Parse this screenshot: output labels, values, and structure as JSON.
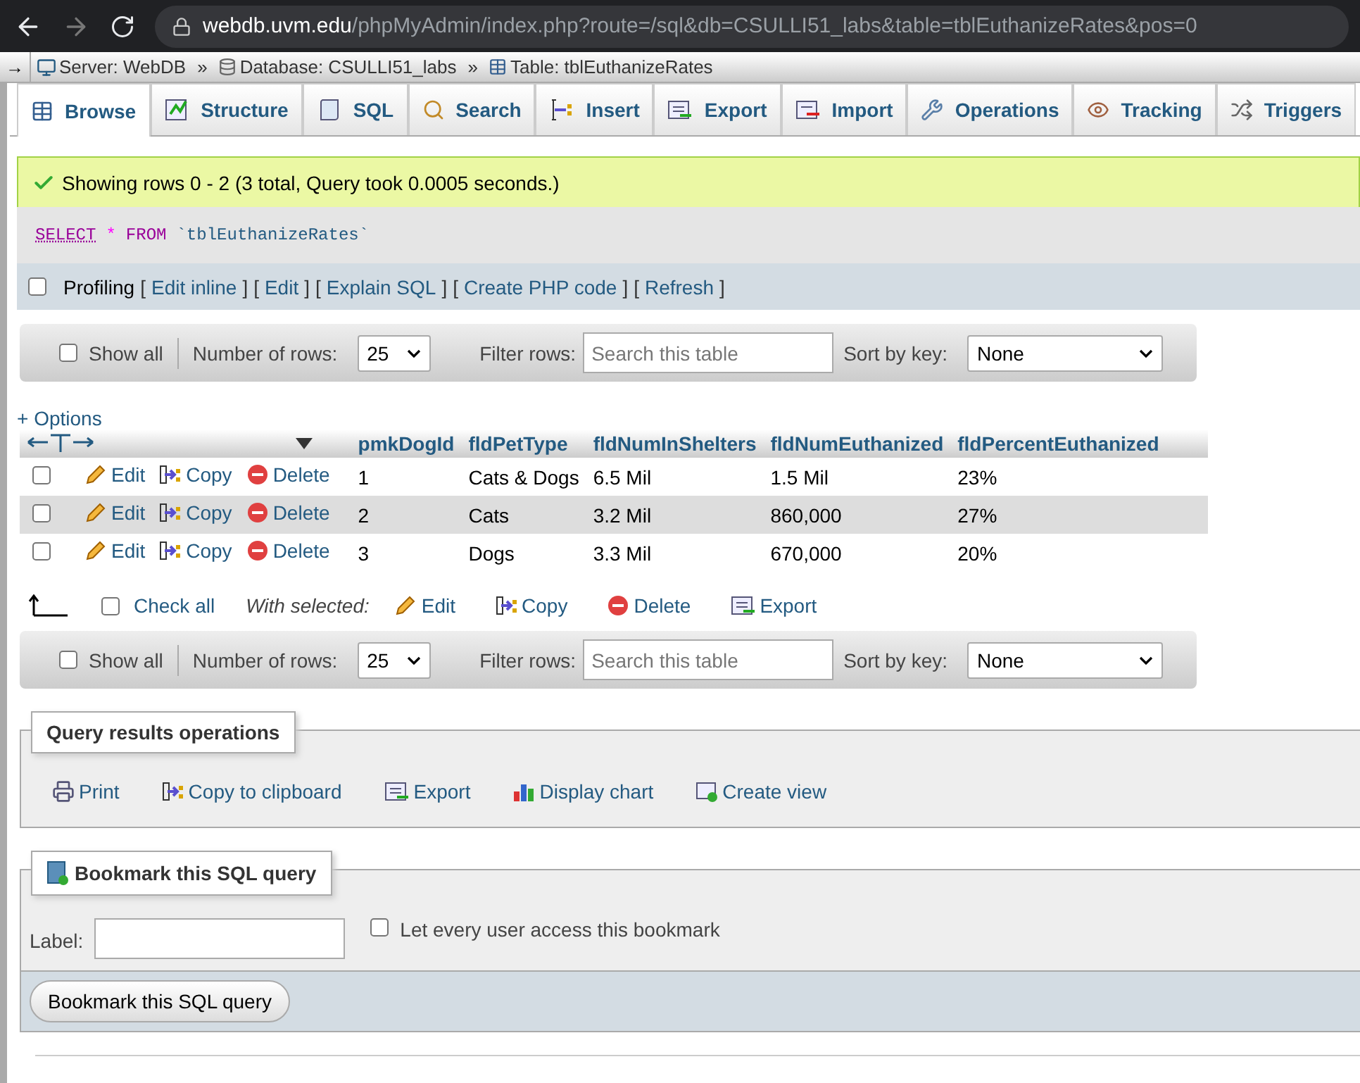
{
  "browser": {
    "host": "webdb.uvm.edu",
    "path": "/phpMyAdmin/index.php?route=/sql&db=CSULLI51_labs&table=tblEuthanizeRates&pos=0"
  },
  "nav_toggle": "→",
  "breadcrumbs": [
    {
      "kind": "server",
      "label": "Server: WebDB"
    },
    {
      "kind": "separator",
      "label": "»"
    },
    {
      "kind": "database",
      "label": "Database: CSULLI51_labs"
    },
    {
      "kind": "separator",
      "label": "»"
    },
    {
      "kind": "table",
      "label": "Table: tblEuthanizeRates"
    }
  ],
  "tabs": [
    {
      "label": "Browse",
      "selected": true
    },
    {
      "label": "Structure",
      "selected": false
    },
    {
      "label": "SQL",
      "selected": false
    },
    {
      "label": "Search",
      "selected": false
    },
    {
      "label": "Insert",
      "selected": false
    },
    {
      "label": "Export",
      "selected": false
    },
    {
      "label": "Import",
      "selected": false
    },
    {
      "label": "Operations",
      "selected": false
    },
    {
      "label": "Tracking",
      "selected": false
    },
    {
      "label": "Triggers",
      "selected": false
    }
  ],
  "message": "Showing rows 0 - 2 (3 total, Query took 0.0005 seconds.)",
  "sql": [
    {
      "kind": "keyword",
      "text": "SELECT"
    },
    {
      "kind": "operator",
      "text": "*"
    },
    {
      "kind": "keyword",
      "text": "FROM"
    },
    {
      "kind": "identifier",
      "text": "`tblEuthanizeRates`"
    }
  ],
  "profiling": {
    "label": "Profiling",
    "checked": false,
    "links": [
      {
        "open": "[",
        "label": "Edit inline",
        "close": "]"
      },
      {
        "open": "[",
        "label": "Edit",
        "close": "]"
      },
      {
        "open": "[",
        "label": "Explain SQL",
        "close": "]"
      },
      {
        "open": "[",
        "label": "Create PHP code",
        "close": "]"
      },
      {
        "open": "[",
        "label": "Refresh",
        "close": "]"
      }
    ]
  },
  "navigation_bars": [
    {
      "show_all": "Show all",
      "show_all_checked": false,
      "rows_label": "Number of rows:",
      "rows_value": "25",
      "filter_label": "Filter rows:",
      "filter_placeholder": "Search this table",
      "sort_label": "Sort by key:",
      "sort_value": "None"
    },
    {
      "show_all": "Show all",
      "show_all_checked": false,
      "rows_label": "Number of rows:",
      "rows_value": "25",
      "filter_label": "Filter rows:",
      "filter_placeholder": "Search this table",
      "sort_label": "Sort by key:",
      "sort_value": "None"
    }
  ],
  "options_link": "+ Options",
  "table": {
    "columns": [
      "pmkDogId",
      "fldPetType",
      "fldNumInShelters",
      "fldNumEuthanized",
      "fldPercentEuthanized"
    ],
    "rows": [
      {
        "checked": false,
        "actions": [
          {
            "kind": "edit",
            "label": "Edit"
          },
          {
            "kind": "copy",
            "label": "Copy"
          },
          {
            "kind": "delete",
            "label": "Delete"
          }
        ],
        "cells": [
          "1",
          "Cats & Dogs",
          "6.5 Mil",
          "1.5 Mil",
          "23%"
        ]
      },
      {
        "checked": false,
        "actions": [
          {
            "kind": "edit",
            "label": "Edit"
          },
          {
            "kind": "copy",
            "label": "Copy"
          },
          {
            "kind": "delete",
            "label": "Delete"
          }
        ],
        "cells": [
          "2",
          "Cats",
          "3.2 Mil",
          "860,000",
          "27%"
        ]
      },
      {
        "checked": false,
        "actions": [
          {
            "kind": "edit",
            "label": "Edit"
          },
          {
            "kind": "copy",
            "label": "Copy"
          },
          {
            "kind": "delete",
            "label": "Delete"
          }
        ],
        "cells": [
          "3",
          "Dogs",
          "3.3 Mil",
          "670,000",
          "20%"
        ]
      }
    ]
  },
  "bulk": {
    "check_all": "Check all",
    "checked": false,
    "with_selected": "With selected:",
    "actions": [
      {
        "kind": "edit",
        "label": "Edit"
      },
      {
        "kind": "copy",
        "label": "Copy"
      },
      {
        "kind": "delete",
        "label": "Delete"
      },
      {
        "kind": "export",
        "label": "Export"
      }
    ]
  },
  "query_operations": {
    "legend": "Query results operations",
    "actions": [
      {
        "kind": "print",
        "label": "Print"
      },
      {
        "kind": "copy",
        "label": "Copy to clipboard"
      },
      {
        "kind": "export",
        "label": "Export"
      },
      {
        "kind": "chart",
        "label": "Display chart"
      },
      {
        "kind": "view",
        "label": "Create view"
      }
    ]
  },
  "bookmark": {
    "legend": "Bookmark this SQL query",
    "label_label": "Label:",
    "share_label": "Let every user access this bookmark",
    "share_checked": false,
    "submit": "Bookmark this SQL query"
  }
}
